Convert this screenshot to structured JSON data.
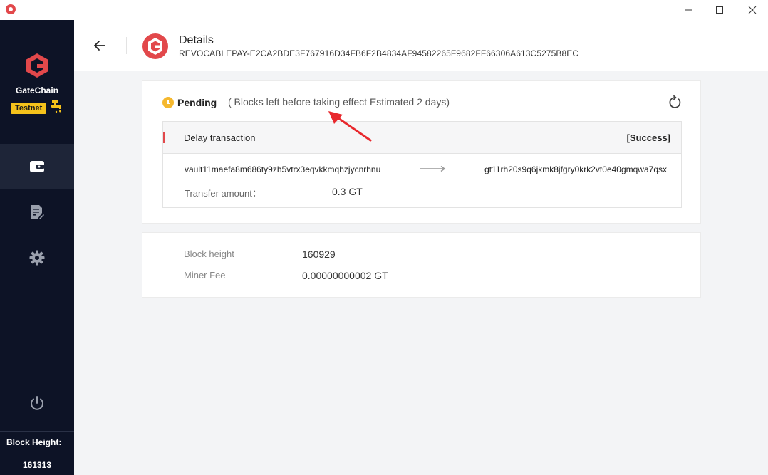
{
  "window": {
    "controls": {
      "minimize": "minimize",
      "maximize": "maximize",
      "close": "close"
    }
  },
  "sidebar": {
    "brand": "GateChain",
    "network_badge": "Testnet",
    "nav": [
      {
        "name": "wallet",
        "icon": "wallet-icon",
        "active": true
      },
      {
        "name": "records",
        "icon": "document-edit-icon",
        "active": false
      },
      {
        "name": "settings",
        "icon": "gear-icon",
        "active": false
      }
    ],
    "block_height_label": "Block Height:",
    "block_height_value": "161313"
  },
  "header": {
    "title": "Details",
    "subtitle": "REVOCABLEPAY-E2CA2BDE3F767916D34FB6F2B4834AF94582265F9682FF66306A613C5275B8EC"
  },
  "status": {
    "label": "Pending",
    "note": "( Blocks left before taking effect Estimated 2 days)",
    "color": "#f5b82e"
  },
  "transaction": {
    "type": "Delay transaction",
    "status": "[Success]",
    "from": "vault11maefa8m686ty9zh5vtrx3eqvkkmqhzjycnrhnu",
    "to": "gt11rh20s9q6jkmk8jfgry0krk2vt0e40gmqwa7qsx",
    "amount_label": "Transfer amount：",
    "amount": "0.3 GT"
  },
  "details": [
    {
      "label": "Block height",
      "value": "160929"
    },
    {
      "label": "Miner Fee",
      "value": "0.00000000002 GT"
    }
  ],
  "colors": {
    "accent": "#e2484b",
    "sidebar_bg": "#0d1326",
    "badge": "#f5c21b"
  }
}
